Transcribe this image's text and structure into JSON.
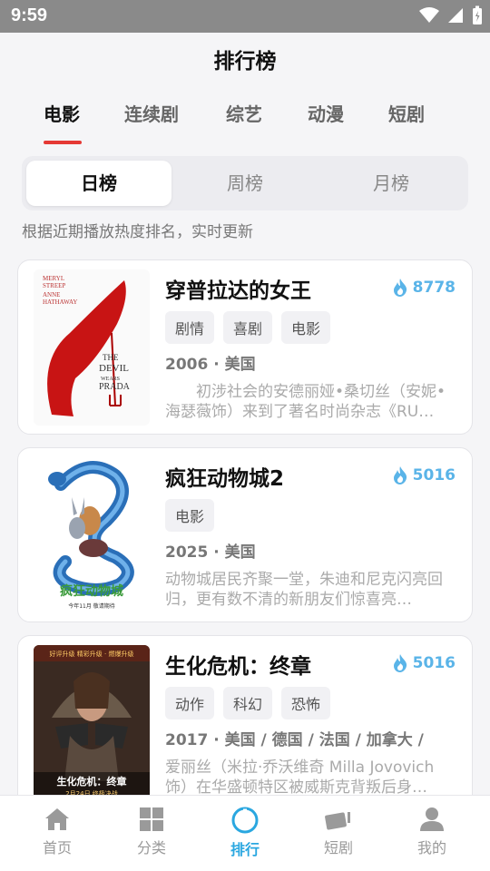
{
  "status_bar": {
    "time": "9:59"
  },
  "header": {
    "title": "排行榜"
  },
  "category_tabs": [
    "电影",
    "连续剧",
    "综艺",
    "动漫",
    "短剧"
  ],
  "category_active": "电影",
  "period_tabs": [
    "日榜",
    "周榜",
    "月榜"
  ],
  "period_active": "日榜",
  "subtitle": "根据近期播放热度排名，实时更新",
  "ranking": [
    {
      "title": "穿普拉达的女王",
      "heat": "8778",
      "tags": [
        "剧情",
        "喜剧",
        "电影"
      ],
      "meta": "2006 · 美国",
      "desc": "初涉社会的安德丽娅•桑切丝（安妮•海瑟薇饰）来到了著名时尚杂志《RU…",
      "poster_text": [
        "The Devil Wears Prada",
        "STREEP",
        "HATHAWAY"
      ]
    },
    {
      "title": "疯狂动物城2",
      "heat": "5016",
      "tags": [
        "电影"
      ],
      "meta": "2025 · 美国",
      "desc": "动物城居民齐聚一堂，朱迪和尼克闪亮回归，更有数不清的新朋友们惊喜亮…",
      "poster_text": [
        "疯狂动物城",
        "今年11月 敬请期待"
      ]
    },
    {
      "title": "生化危机：终章",
      "heat": "5016",
      "tags": [
        "动作",
        "科幻",
        "恐怖"
      ],
      "meta": "2017 · 美国 / 德国 / 法国 / 加拿大 /",
      "desc": "爱丽丝（米拉·乔沃维奇 Milla Jovovich 饰）在华盛顿特区被威斯克背叛后身…",
      "poster_text": [
        "生化危机：终章",
        "2月24日 终极决战"
      ]
    }
  ],
  "bottom_nav": [
    {
      "label": "首页",
      "icon": "home-icon"
    },
    {
      "label": "分类",
      "icon": "grid-icon"
    },
    {
      "label": "排行",
      "icon": "ranking-circle-icon"
    },
    {
      "label": "短剧",
      "icon": "short-drama-icon"
    },
    {
      "label": "我的",
      "icon": "profile-icon"
    }
  ],
  "bottom_nav_active": "排行",
  "colors": {
    "accent_red": "#e53935",
    "accent_blue": "#2aa7e0",
    "heat_blue": "#5ab4e8",
    "status_bar": "#8a8a8a"
  }
}
